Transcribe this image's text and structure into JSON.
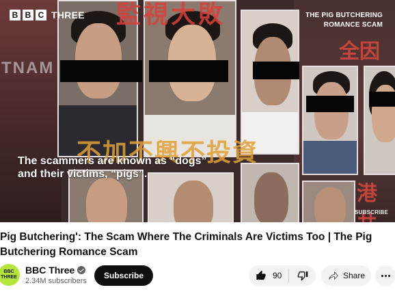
{
  "video": {
    "brand": {
      "block1": "B",
      "block2": "B",
      "block3": "C",
      "name": "THREE"
    },
    "overlay_title": [
      "THE PIG BUTCHERING",
      "ROMANCE SCAM"
    ],
    "caption": [
      "The scammers are known as “dogs”",
      "and their victims, “pigs”."
    ],
    "watermark": "SUBSCRIBE",
    "map_text": "TNAM",
    "chinese_text": {
      "top": "監視大敗",
      "middle": "不加不興不投資",
      "right": "全因",
      "right_bottom": "港共"
    }
  },
  "title": {
    "line1": "Pig Butchering': The Scam Where The Criminals Are Victims Too | The Pig",
    "line2": "Butchering Romance Scam"
  },
  "channel": {
    "avatar_line1": "BBC",
    "avatar_line2": "THREE",
    "name": "BBC Three",
    "subscribers": "2.34M subscribers",
    "subscribe_label": "Subscribe"
  },
  "actions": {
    "like_count": "90",
    "share_label": "Share"
  },
  "colors": {
    "accent_avatar": "#b4e63c",
    "button_dark": "#0f0f0f",
    "pill_bg": "#f2f2f2"
  }
}
